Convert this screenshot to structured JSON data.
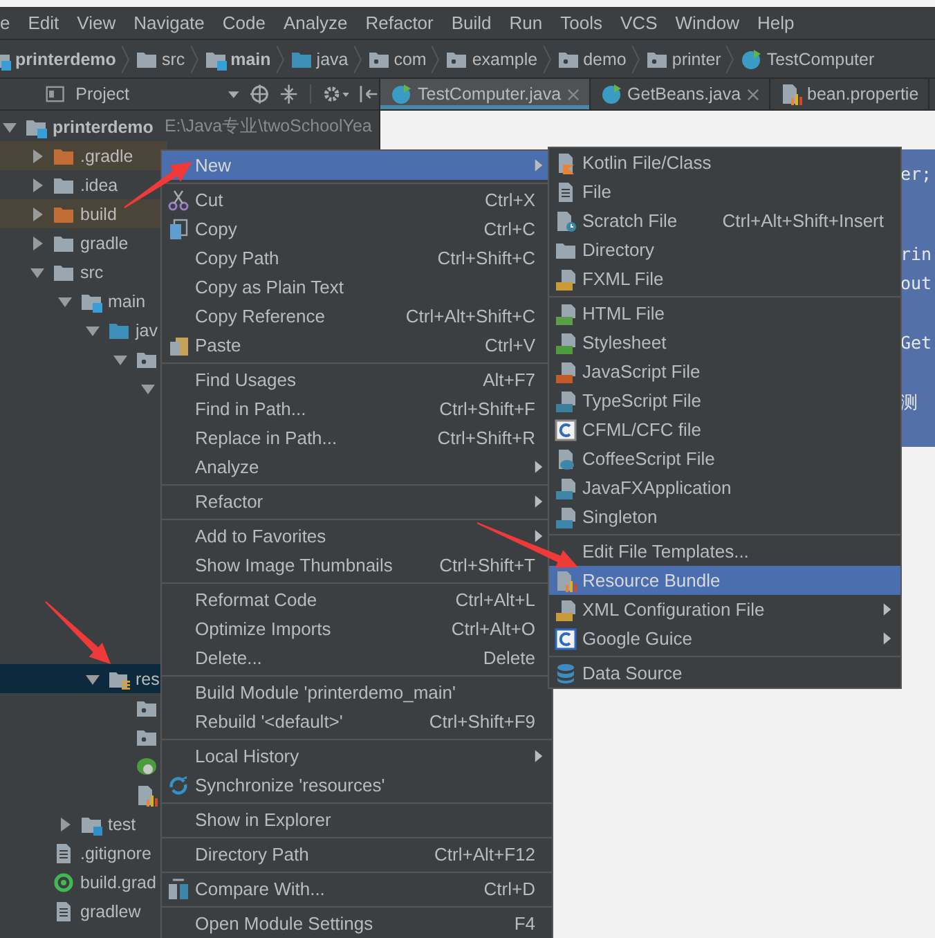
{
  "menu_bar": [
    "e",
    "Edit",
    "View",
    "Navigate",
    "Code",
    "Analyze",
    "Refactor",
    "Build",
    "Run",
    "Tools",
    "VCS",
    "Window",
    "Help"
  ],
  "breadcrumbs": [
    {
      "label": "printerdemo",
      "kind": "module"
    },
    {
      "label": "src",
      "kind": "folder"
    },
    {
      "label": "main",
      "kind": "module"
    },
    {
      "label": "java",
      "kind": "source"
    },
    {
      "label": "com",
      "kind": "package"
    },
    {
      "label": "example",
      "kind": "package"
    },
    {
      "label": "demo",
      "kind": "package"
    },
    {
      "label": "printer",
      "kind": "package"
    },
    {
      "label": "TestComputer",
      "kind": "class"
    }
  ],
  "project_panel": {
    "title": "Project"
  },
  "editor_tabs": [
    {
      "label": "TestComputer.java",
      "kind": "class",
      "selected": true,
      "closable": true
    },
    {
      "label": "GetBeans.java",
      "kind": "class",
      "selected": false,
      "closable": true
    },
    {
      "label": "bean.propertie",
      "kind": "properties",
      "selected": false,
      "closable": false
    }
  ],
  "project_tree": [
    {
      "label": "printerdemo",
      "path": "E:\\Java专业\\twoSchoolYea",
      "kind": "module",
      "expanded": true,
      "selected": false,
      "excluded": false,
      "children": [
        {
          "label": ".gradle",
          "kind": "excluded-folder",
          "expanded": false,
          "selected": false,
          "excluded": true
        },
        {
          "label": ".idea",
          "kind": "folder",
          "expanded": false,
          "selected": false,
          "excluded": false
        },
        {
          "label": "build",
          "kind": "excluded-folder",
          "expanded": false,
          "selected": false,
          "excluded": true
        },
        {
          "label": "gradle",
          "kind": "folder",
          "expanded": false,
          "selected": false,
          "excluded": false
        },
        {
          "label": "src",
          "kind": "folder",
          "expanded": true,
          "selected": false,
          "excluded": false,
          "children": [
            {
              "label": "main",
              "kind": "module",
              "expanded": true,
              "selected": false,
              "excluded": false,
              "children": [
                {
                  "label": "jav",
                  "kind": "source-folder",
                  "expanded": true,
                  "selected": false,
                  "excluded": false,
                  "children": [
                    {
                      "kind": "package",
                      "expanded": true,
                      "selected": false,
                      "excluded": false,
                      "children": [
                        {
                          "kind": "covered-folder",
                          "expanded": true,
                          "selected": false,
                          "excluded": false
                        }
                      ]
                    }
                  ]
                },
                {
                  "label": "res",
                  "kind": "resources-folder",
                  "expanded": true,
                  "selected": true,
                  "excluded": false,
                  "children": [
                    {
                      "kind": "package-leaf",
                      "selected": false,
                      "excluded": false
                    },
                    {
                      "kind": "package-leaf",
                      "selected": false,
                      "excluded": false
                    },
                    {
                      "kind": "spring-file",
                      "selected": false,
                      "excluded": false
                    },
                    {
                      "kind": "properties-file",
                      "selected": false,
                      "excluded": false
                    }
                  ]
                }
              ]
            },
            {
              "label": "test",
              "kind": "test-folder",
              "expanded": false,
              "selected": false,
              "excluded": false
            }
          ]
        },
        {
          "label": ".gitignore",
          "kind": "text-file",
          "selected": false,
          "excluded": false
        },
        {
          "label": "build.grad",
          "kind": "gradle-file",
          "selected": false,
          "excluded": false
        },
        {
          "label": "gradlew",
          "kind": "text-file",
          "selected": false,
          "excluded": false
        }
      ]
    }
  ],
  "code_lines": [
    {
      "kind": "code",
      "text": "er;",
      "selected": true
    },
    {
      "kind": "blank",
      "selected": true
    },
    {
      "kind": "blank",
      "selected": true
    },
    {
      "kind": "code",
      "text": "rin",
      "selected": true
    },
    {
      "kind": "code",
      "text": "out",
      "selected": true
    },
    {
      "kind": "blank",
      "selected": true
    },
    {
      "kind": "code",
      "text": "Get",
      "selected": true
    },
    {
      "kind": "blank",
      "selected": true
    },
    {
      "kind": "code",
      "text": "测",
      "selected": true
    },
    {
      "kind": "blank",
      "selected": true
    }
  ],
  "context_menu": [
    {
      "kind": "plain",
      "label": "New",
      "selected": true,
      "submenu": true
    },
    {
      "kind": "separator"
    },
    {
      "kind": "cut",
      "label": "Cut",
      "shortcut": "Ctrl+X",
      "selected": false,
      "submenu": false
    },
    {
      "kind": "copy",
      "label": "Copy",
      "shortcut": "Ctrl+C",
      "selected": false,
      "submenu": false
    },
    {
      "kind": "plain",
      "label": "Copy Path",
      "shortcut": "Ctrl+Shift+C",
      "selected": false,
      "submenu": false
    },
    {
      "kind": "plain",
      "label": "Copy as Plain Text",
      "selected": false,
      "submenu": false
    },
    {
      "kind": "plain",
      "label": "Copy Reference",
      "shortcut": "Ctrl+Alt+Shift+C",
      "selected": false,
      "submenu": false
    },
    {
      "kind": "paste",
      "label": "Paste",
      "shortcut": "Ctrl+V",
      "selected": false,
      "submenu": false
    },
    {
      "kind": "separator"
    },
    {
      "kind": "plain",
      "label": "Find Usages",
      "shortcut": "Alt+F7",
      "selected": false,
      "submenu": false
    },
    {
      "kind": "plain",
      "label": "Find in Path...",
      "shortcut": "Ctrl+Shift+F",
      "selected": false,
      "submenu": false
    },
    {
      "kind": "plain",
      "label": "Replace in Path...",
      "shortcut": "Ctrl+Shift+R",
      "selected": false,
      "submenu": false
    },
    {
      "kind": "plain",
      "label": "Analyze",
      "selected": false,
      "submenu": true
    },
    {
      "kind": "separator"
    },
    {
      "kind": "plain",
      "label": "Refactor",
      "selected": false,
      "submenu": true
    },
    {
      "kind": "separator"
    },
    {
      "kind": "plain",
      "label": "Add to Favorites",
      "selected": false,
      "submenu": true
    },
    {
      "kind": "plain",
      "label": "Show Image Thumbnails",
      "shortcut": "Ctrl+Shift+T",
      "selected": false,
      "submenu": false
    },
    {
      "kind": "separator"
    },
    {
      "kind": "plain",
      "label": "Reformat Code",
      "shortcut": "Ctrl+Alt+L",
      "selected": false,
      "submenu": false
    },
    {
      "kind": "plain",
      "label": "Optimize Imports",
      "shortcut": "Ctrl+Alt+O",
      "selected": false,
      "submenu": false
    },
    {
      "kind": "plain",
      "label": "Delete...",
      "shortcut": "Delete",
      "selected": false,
      "submenu": false
    },
    {
      "kind": "separator"
    },
    {
      "kind": "plain",
      "label": "Build Module 'printerdemo_main'",
      "selected": false,
      "submenu": false
    },
    {
      "kind": "plain",
      "label": "Rebuild '<default>'",
      "shortcut": "Ctrl+Shift+F9",
      "selected": false,
      "submenu": false
    },
    {
      "kind": "separator"
    },
    {
      "kind": "plain",
      "label": "Local History",
      "selected": false,
      "submenu": true
    },
    {
      "kind": "sync",
      "label": "Synchronize 'resources'",
      "selected": false,
      "submenu": false
    },
    {
      "kind": "separator"
    },
    {
      "kind": "plain",
      "label": "Show in Explorer",
      "selected": false,
      "submenu": false
    },
    {
      "kind": "separator"
    },
    {
      "kind": "plain",
      "label": "Directory Path",
      "shortcut": "Ctrl+Alt+F12",
      "selected": false,
      "submenu": false
    },
    {
      "kind": "separator"
    },
    {
      "kind": "compare",
      "label": "Compare With...",
      "shortcut": "Ctrl+D",
      "selected": false,
      "submenu": false
    },
    {
      "kind": "separator"
    },
    {
      "kind": "plain",
      "label": "Open Module Settings",
      "shortcut": "F4",
      "selected": false,
      "submenu": false
    }
  ],
  "new_submenu": [
    {
      "kind": "kotlin",
      "label": "Kotlin File/Class",
      "selected": false,
      "submenu": false
    },
    {
      "kind": "file",
      "label": "File",
      "selected": false,
      "submenu": false
    },
    {
      "kind": "scratch",
      "label": "Scratch File",
      "shortcut": "Ctrl+Alt+Shift+Insert",
      "selected": false,
      "submenu": false
    },
    {
      "kind": "directory",
      "label": "Directory",
      "selected": false,
      "submenu": false
    },
    {
      "kind": "fxml",
      "label": "FXML File",
      "selected": false,
      "submenu": false
    },
    {
      "kind": "separator"
    },
    {
      "kind": "html",
      "label": "HTML File",
      "selected": false,
      "submenu": false
    },
    {
      "kind": "css",
      "label": "Stylesheet",
      "selected": false,
      "submenu": false
    },
    {
      "kind": "js",
      "label": "JavaScript File",
      "selected": false,
      "submenu": false
    },
    {
      "kind": "ts",
      "label": "TypeScript File",
      "selected": false,
      "submenu": false
    },
    {
      "kind": "cfml",
      "label": "CFML/CFC file",
      "selected": false,
      "submenu": false
    },
    {
      "kind": "coffee",
      "label": "CoffeeScript File",
      "selected": false,
      "submenu": false
    },
    {
      "kind": "javafx",
      "label": "JavaFXApplication",
      "selected": false,
      "submenu": false
    },
    {
      "kind": "javafx",
      "label": "Singleton",
      "selected": false,
      "submenu": false
    },
    {
      "kind": "separator"
    },
    {
      "kind": "plain",
      "label": "Edit File Templates...",
      "selected": false,
      "submenu": false
    },
    {
      "kind": "bundle",
      "label": "Resource Bundle",
      "selected": true,
      "submenu": false
    },
    {
      "kind": "xml",
      "label": "XML Configuration File",
      "selected": false,
      "submenu": true
    },
    {
      "kind": "guice",
      "label": "Google Guice",
      "selected": false,
      "submenu": true
    },
    {
      "kind": "separator"
    },
    {
      "kind": "database",
      "label": "Data Source",
      "selected": false,
      "submenu": false
    }
  ]
}
